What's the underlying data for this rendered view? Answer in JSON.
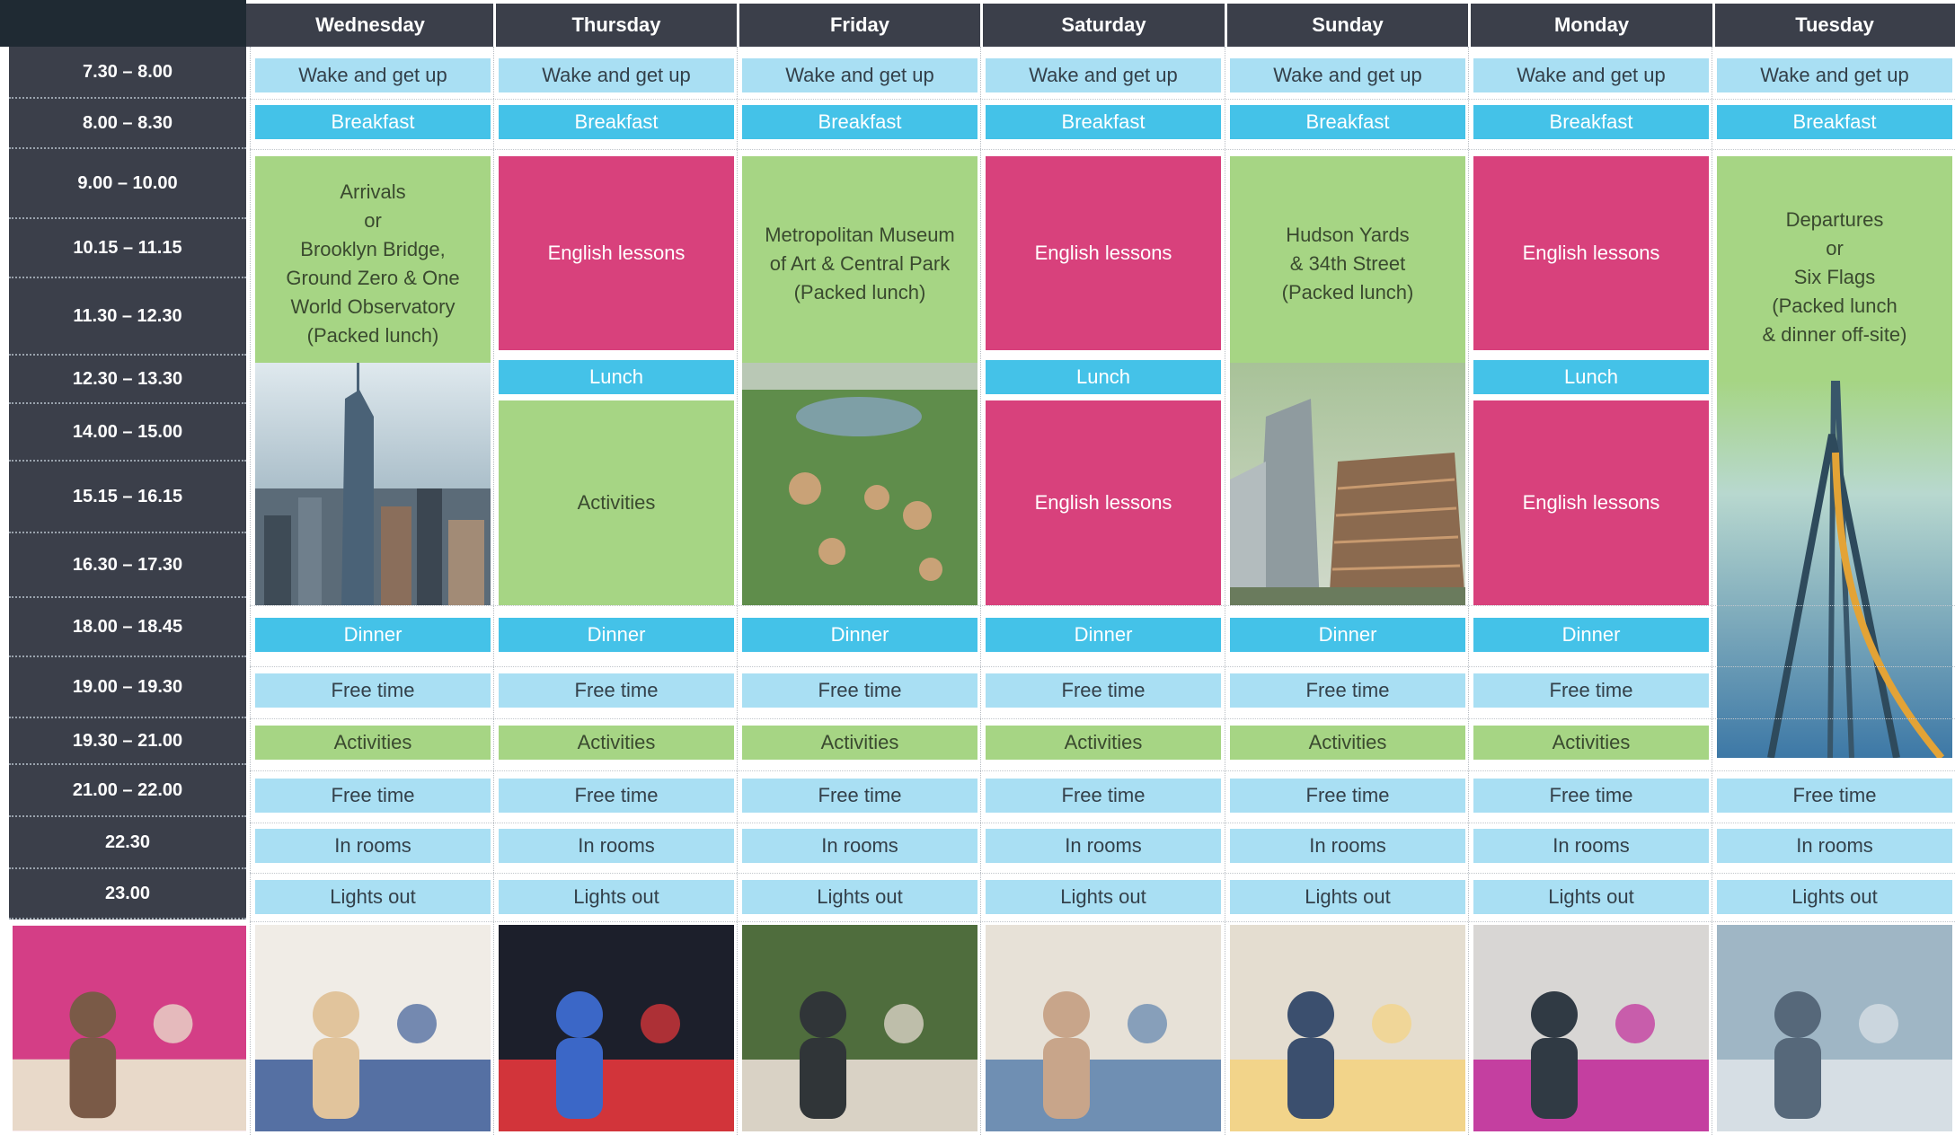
{
  "days": [
    "Wednesday",
    "Thursday",
    "Friday",
    "Saturday",
    "Sunday",
    "Monday",
    "Tuesday"
  ],
  "times": [
    "7.30 – 8.00",
    "8.00 – 8.30",
    "9.00 – 10.00",
    "10.15 – 11.15",
    "11.30 – 12.30",
    "12.30 – 13.30",
    "14.00 – 15.00",
    "15.15 – 16.15",
    "16.30 – 17.30",
    "18.00 – 18.45",
    "19.00 – 19.30",
    "19.30 – 21.00",
    "21.00 – 22.00",
    "22.30",
    "23.00"
  ],
  "labels": {
    "wake": "Wake and get up",
    "breakfast": "Breakfast",
    "lunch": "Lunch",
    "dinner": "Dinner",
    "free_time": "Free time",
    "activities": "Activities",
    "in_rooms": "In rooms",
    "lights_out": "Lights out",
    "english": "English lessons"
  },
  "excursions": {
    "wednesday": "Arrivals\nor\nBrooklyn Bridge,\nGround Zero & One\nWorld Observatory\n(Packed lunch)",
    "friday": "Metropolitan Museum\nof Art & Central Park\n(Packed lunch)",
    "sunday": "Hudson Yards\n& 34th Street\n(Packed lunch)",
    "tuesday": "Departures\nor\nSix Flags\n(Packed lunch\n& dinner off-site)"
  },
  "colors": {
    "header": "#3b3f4a",
    "light_blue": "#a9dff3",
    "blue": "#44c2e8",
    "green": "#a6d584",
    "pink": "#d8417c"
  }
}
